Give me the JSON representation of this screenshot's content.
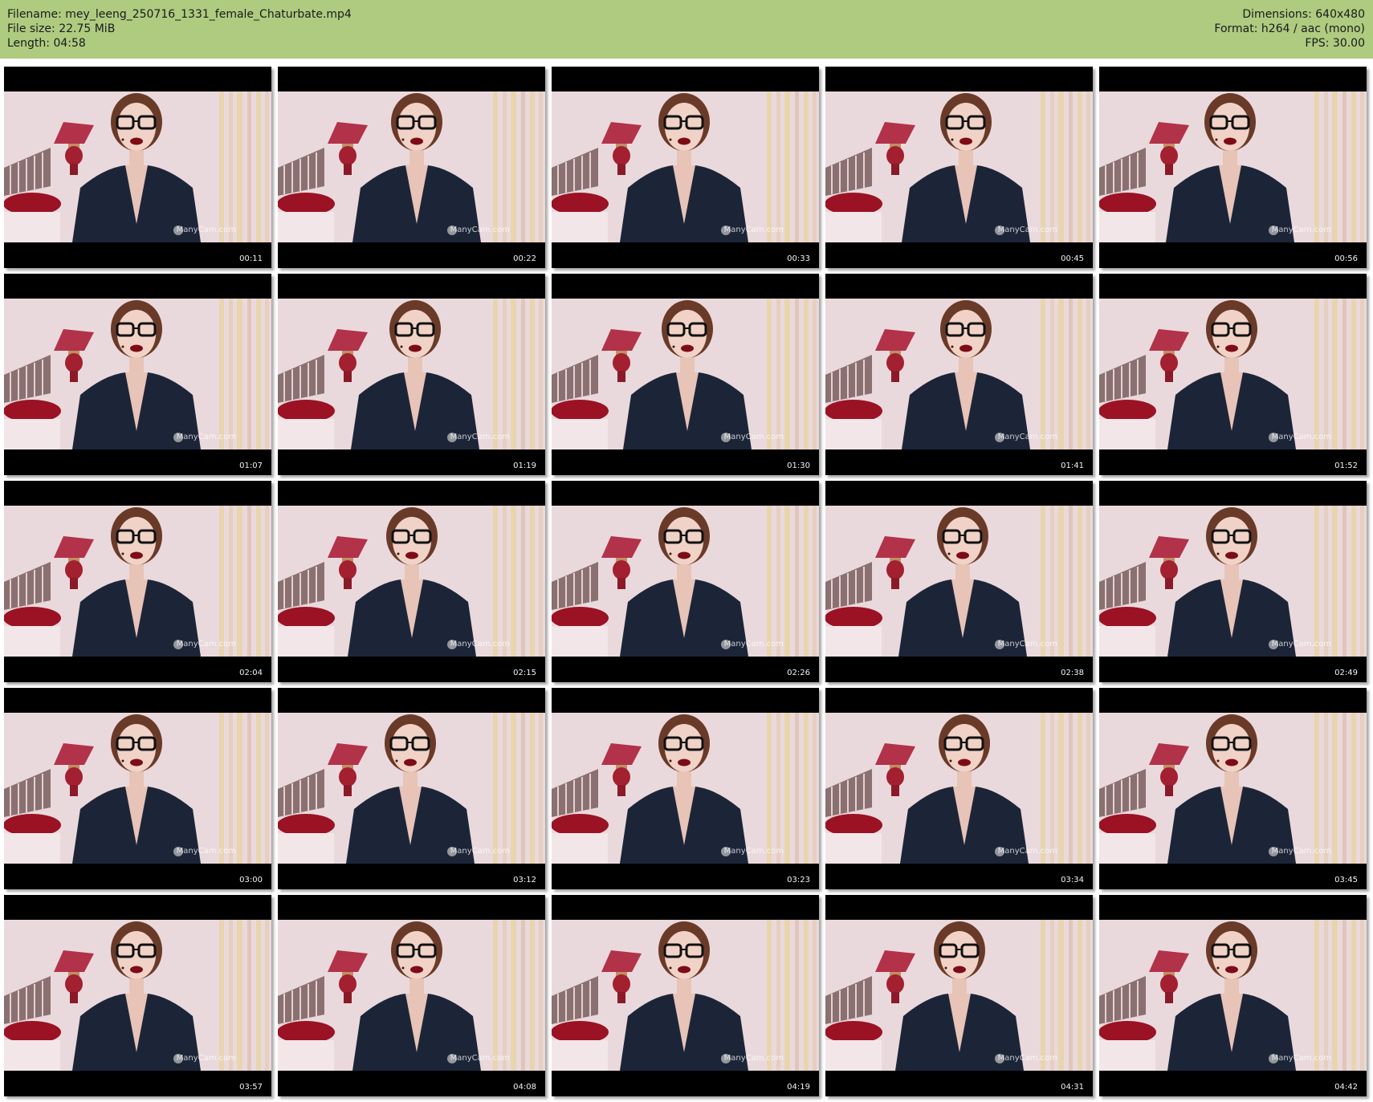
{
  "file_info": {
    "filename": "Filename: mey_leeng_250716_1331_female_Chaturbate.mp4",
    "file_size": "File size: 22.75 MiB",
    "length": "Length: 04:58",
    "dimensions": "Dimensions: 640x480",
    "format": "Format: h264 / aac (mono)",
    "fps": "FPS: 30.00"
  },
  "watermark": "ManyCam.com",
  "colors": {
    "header_bg": "#aecb80",
    "frame_letterbox": "#000000",
    "room_wall": "#ead9dc",
    "shirt": "#1c2538",
    "lamp_shade": "#b2324a",
    "pillow": "#9a1224",
    "lips": "#7d0c16"
  },
  "thumbnails": [
    {
      "timestamp": "00:11"
    },
    {
      "timestamp": "00:22"
    },
    {
      "timestamp": "00:33"
    },
    {
      "timestamp": "00:45"
    },
    {
      "timestamp": "00:56"
    },
    {
      "timestamp": "01:07"
    },
    {
      "timestamp": "01:19"
    },
    {
      "timestamp": "01:30"
    },
    {
      "timestamp": "01:41"
    },
    {
      "timestamp": "01:52"
    },
    {
      "timestamp": "02:04"
    },
    {
      "timestamp": "02:15"
    },
    {
      "timestamp": "02:26"
    },
    {
      "timestamp": "02:38"
    },
    {
      "timestamp": "02:49"
    },
    {
      "timestamp": "03:00"
    },
    {
      "timestamp": "03:12"
    },
    {
      "timestamp": "03:23"
    },
    {
      "timestamp": "03:34"
    },
    {
      "timestamp": "03:45"
    },
    {
      "timestamp": "03:57"
    },
    {
      "timestamp": "04:08"
    },
    {
      "timestamp": "04:19"
    },
    {
      "timestamp": "04:31"
    },
    {
      "timestamp": "04:42"
    }
  ]
}
